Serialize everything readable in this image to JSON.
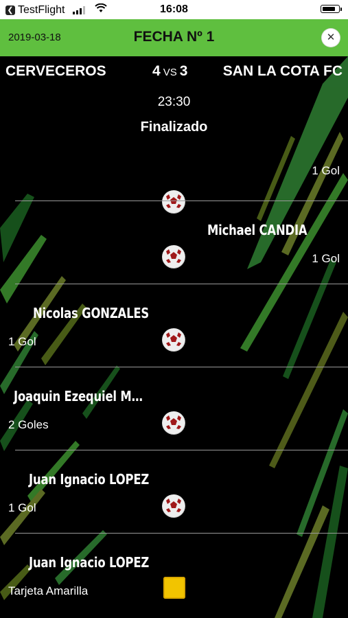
{
  "status_bar": {
    "carrier": "TestFlight",
    "time": "16:08",
    "battery_level": 0.8
  },
  "header": {
    "date": "2019-03-18",
    "title": "FECHA Nº 1",
    "close_icon": "close-icon"
  },
  "match": {
    "home_team": "CERVECEROS",
    "away_team": "SAN LA COTA FC",
    "home_score": "4",
    "vs": "VS",
    "away_score": "3",
    "time": "23:30",
    "status": "Finalizado"
  },
  "events": [
    {
      "player": "",
      "side": "right",
      "detail": "1 Gol",
      "icon": "soccer-ball-icon"
    },
    {
      "player": "Michael CANDIA",
      "side": "right",
      "detail": "1 Gol",
      "icon": "soccer-ball-icon"
    },
    {
      "player": "Nicolas  GONZALES",
      "side": "left",
      "detail": "1 Gol",
      "icon": "soccer-ball-icon"
    },
    {
      "player": "Joaquin Ezequiel M…",
      "side": "left",
      "detail": "2 Goles",
      "icon": "soccer-ball-icon"
    },
    {
      "player": "Juan Ignacio LOPEZ",
      "side": "left",
      "detail": "1 Gol",
      "icon": "soccer-ball-icon"
    },
    {
      "player": "Juan Ignacio LOPEZ",
      "side": "left",
      "detail": "Tarjeta Amarilla",
      "icon": "yellow-card-icon"
    }
  ],
  "colors": {
    "header_bg": "#5fbf3f",
    "background": "#000000",
    "card_yellow": "#f2c400"
  }
}
